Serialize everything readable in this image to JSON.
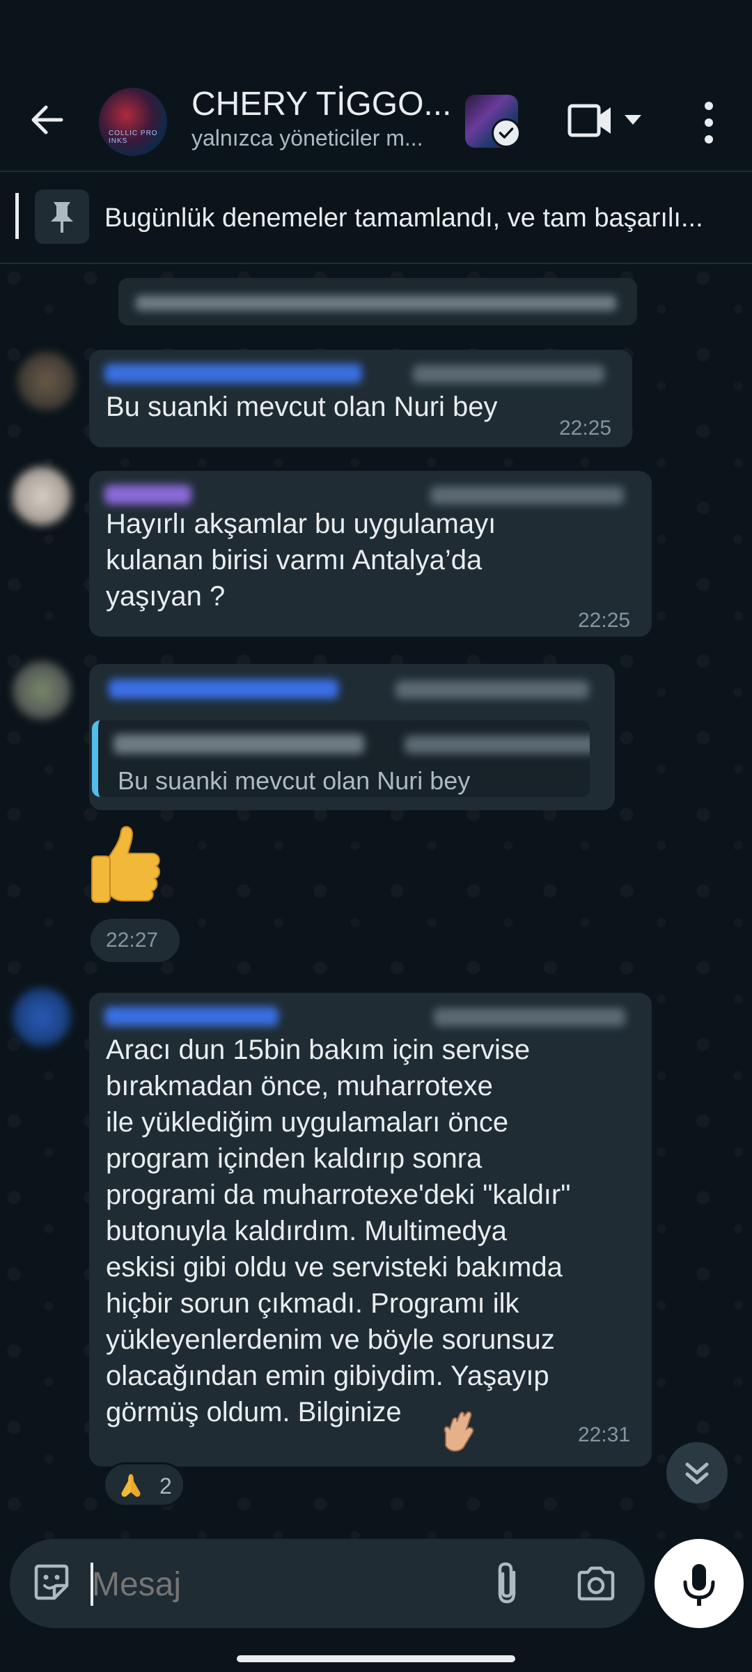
{
  "header": {
    "title": "CHERY TİGGO...",
    "subtitle": "yalnızca yöneticiler m...",
    "group_avatar_text": "COLLIC PRO INKS"
  },
  "pinned": {
    "text": "Bugünlük denemeler tamamlandı, ve tam başarılı..."
  },
  "messages": [
    {
      "text": "Bu suanki mevcut olan Nuri bey",
      "time": "22:25"
    },
    {
      "text": "Hayırlı akşamlar bu uygulamayı\nkulanan birisi varmı Antalya’da\nyaşıyan ?",
      "time": "22:25"
    },
    {
      "quoted_text": "Bu suanki mevcut olan Nuri bey",
      "emoji": "thumbs-up",
      "time": "22:27"
    },
    {
      "text": "Aracı dun 15bin bakım için servise\nbırakmadan önce, muharrotexe\nile yüklediğim uygulamaları önce\nprogram içinden kaldırıp sonra\nprogrami da muharrotexe'deki \"kaldır\"\nbutonuyla kaldırdım. Multimedya\neskisi gibi oldu ve servisteki bakımda\nhiçbir sorun çıkmadı. Programı ilk\nyükleyenlerdenim ve böyle sorunsuz\nolacağından emin gibiydim. Yaşayıp\ngörmüş oldum. Bilginize",
      "time": "22:31",
      "reaction": {
        "emoji": "folded-hands",
        "count": "2"
      }
    }
  ],
  "composer": {
    "placeholder": "Mesaj"
  },
  "colors": {
    "background": "#0b141a",
    "bubble": "#1f2c34",
    "accent_blue": "#53bdeb",
    "muted_text": "#8696a0"
  }
}
